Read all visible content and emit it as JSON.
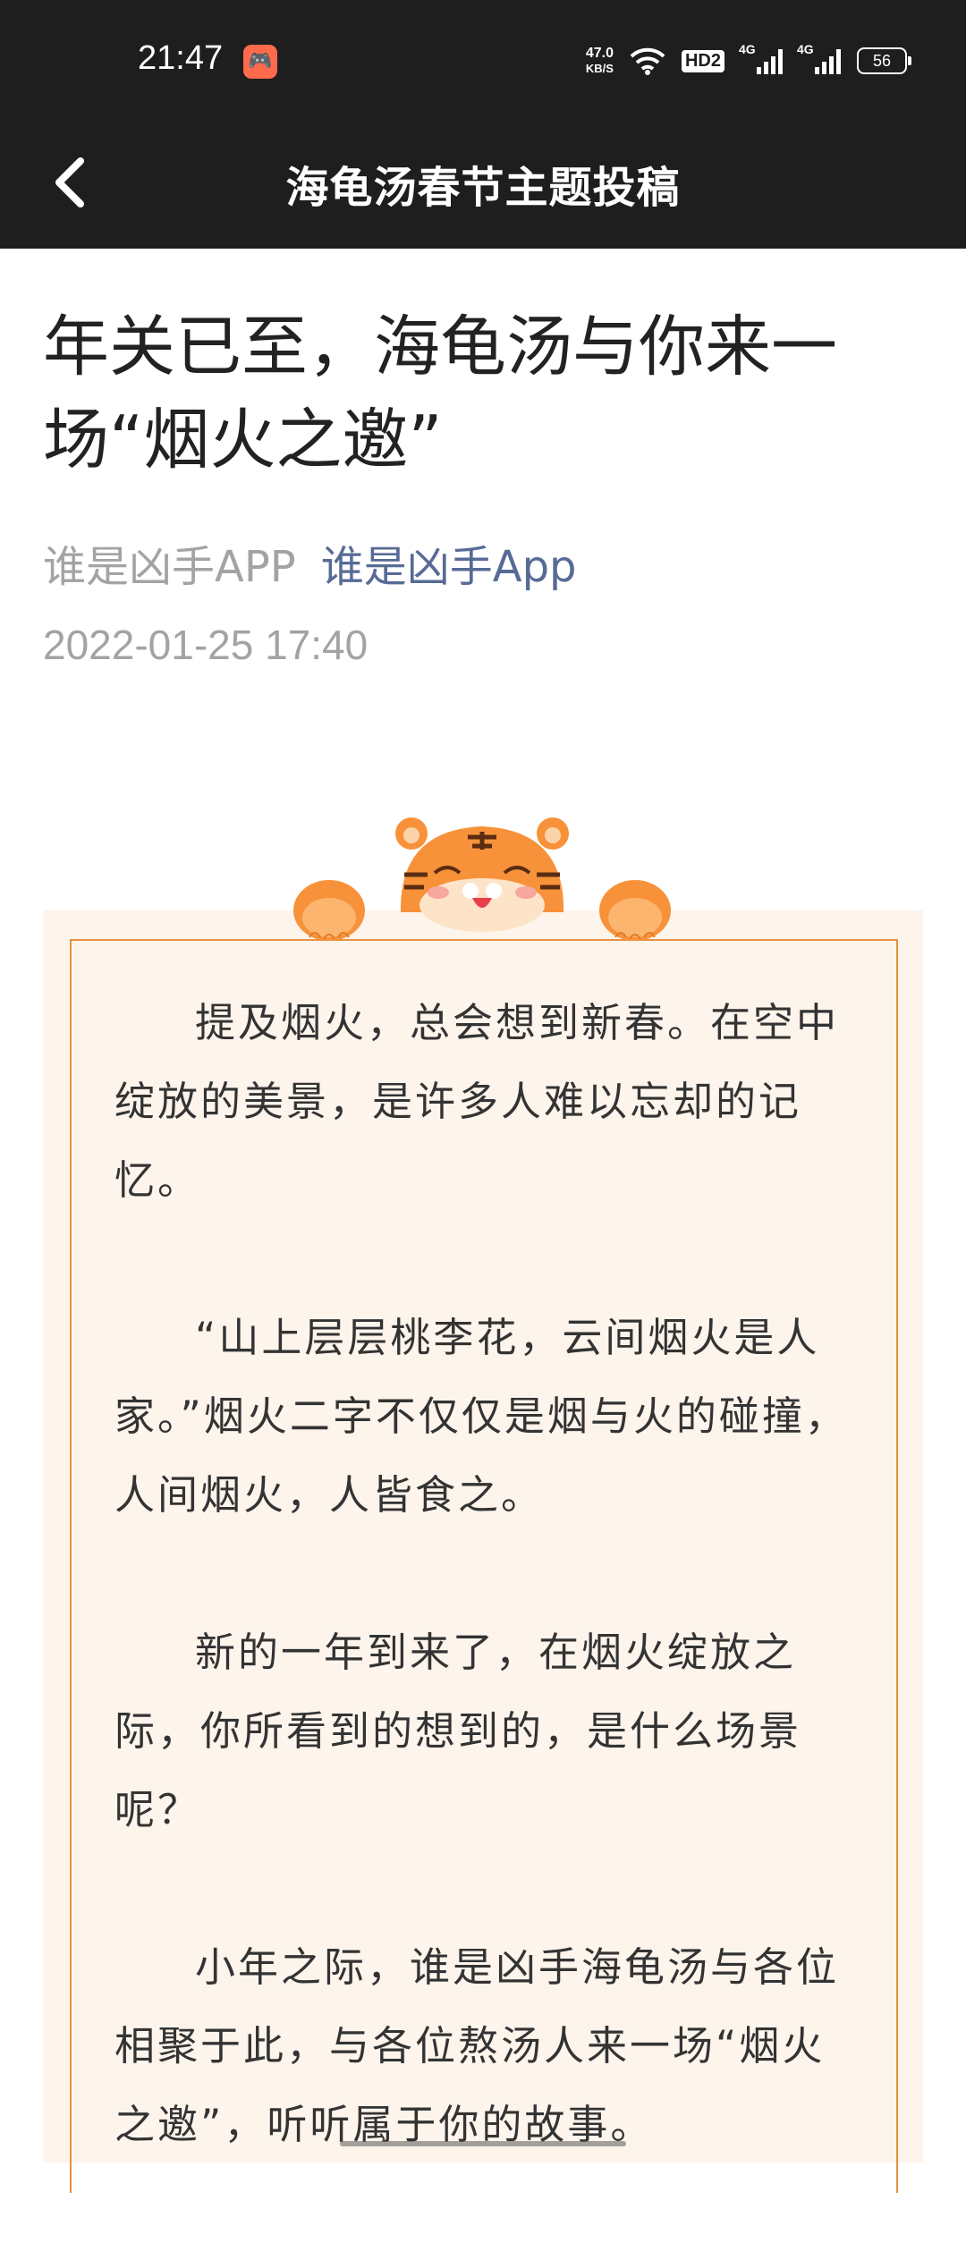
{
  "status_bar": {
    "time": "21:47",
    "speed_value": "47.0",
    "speed_unit": "KB/S",
    "hd_label": "HD2",
    "net1": "4G",
    "net2": "4G",
    "battery": "56"
  },
  "nav": {
    "title": "海龟汤春节主题投稿"
  },
  "article": {
    "title": "年关已至，海龟汤与你来一场“烟火之邀”",
    "source": "谁是凶手APP",
    "author_link": "谁是凶手App",
    "date": "2022-01-25 17:40",
    "paragraphs": [
      "提及烟火，总会想到新春。在空中绽放的美景，是许多人难以忘却的记忆。",
      "“山上层层桃李花，云间烟火是人家。”烟火二字不仅仅是烟与火的碰撞，人间烟火，人皆食之。",
      "新的一年到来了，在烟火绽放之际，你所看到的想到的，是什么场景呢？",
      "小年之际，谁是凶手海龟汤与各位相聚于此，与各位熬汤人来一场“烟火之邀”，听听属于你的故事。"
    ]
  },
  "colors": {
    "header_bg": "#1e1e1e",
    "link": "#576b95",
    "card_bg": "#fdf4ec",
    "card_border": "#e8913f",
    "tiger_orange": "#f7923a"
  }
}
